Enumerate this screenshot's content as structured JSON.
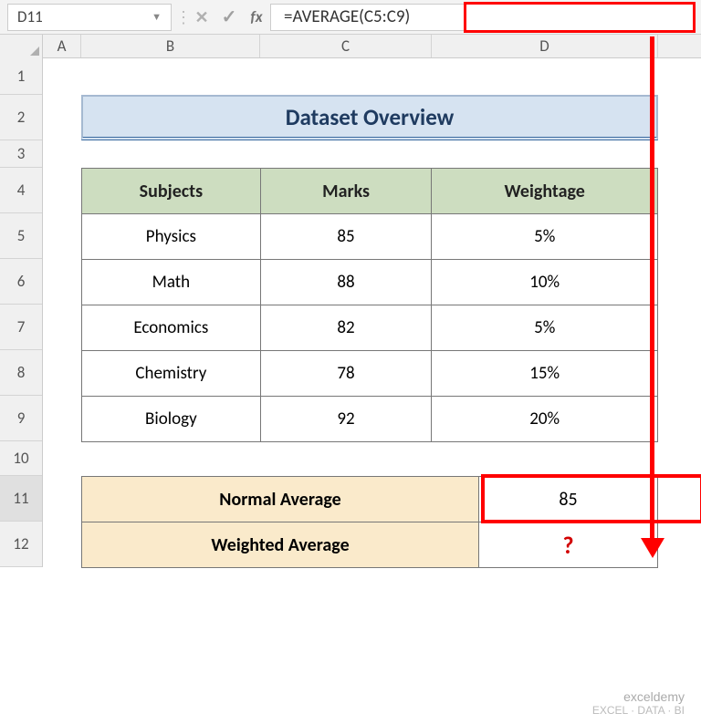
{
  "namebox": {
    "value": "D11"
  },
  "formula_bar": {
    "formula": "=AVERAGE(C5:C9)",
    "fx_label": "fx"
  },
  "columns": {
    "A": "A",
    "B": "B",
    "C": "C",
    "D": "D"
  },
  "rows": [
    "1",
    "2",
    "3",
    "4",
    "5",
    "6",
    "7",
    "8",
    "9",
    "10",
    "11",
    "12"
  ],
  "title": "Dataset Overview",
  "table": {
    "headers": {
      "subjects": "Subjects",
      "marks": "Marks",
      "weightage": "Weightage"
    },
    "rows": [
      {
        "subject": "Physics",
        "marks": "85",
        "weightage": "5%"
      },
      {
        "subject": "Math",
        "marks": "88",
        "weightage": "10%"
      },
      {
        "subject": "Economics",
        "marks": "82",
        "weightage": "5%"
      },
      {
        "subject": "Chemistry",
        "marks": "78",
        "weightage": "15%"
      },
      {
        "subject": "Biology",
        "marks": "92",
        "weightage": "20%"
      }
    ]
  },
  "summary": {
    "normal_label": "Normal Average",
    "normal_value": "85",
    "weighted_label": "Weighted Average",
    "weighted_value": "?"
  },
  "watermark": {
    "brand": "exceldemy",
    "tagline": "EXCEL · DATA · BI"
  }
}
